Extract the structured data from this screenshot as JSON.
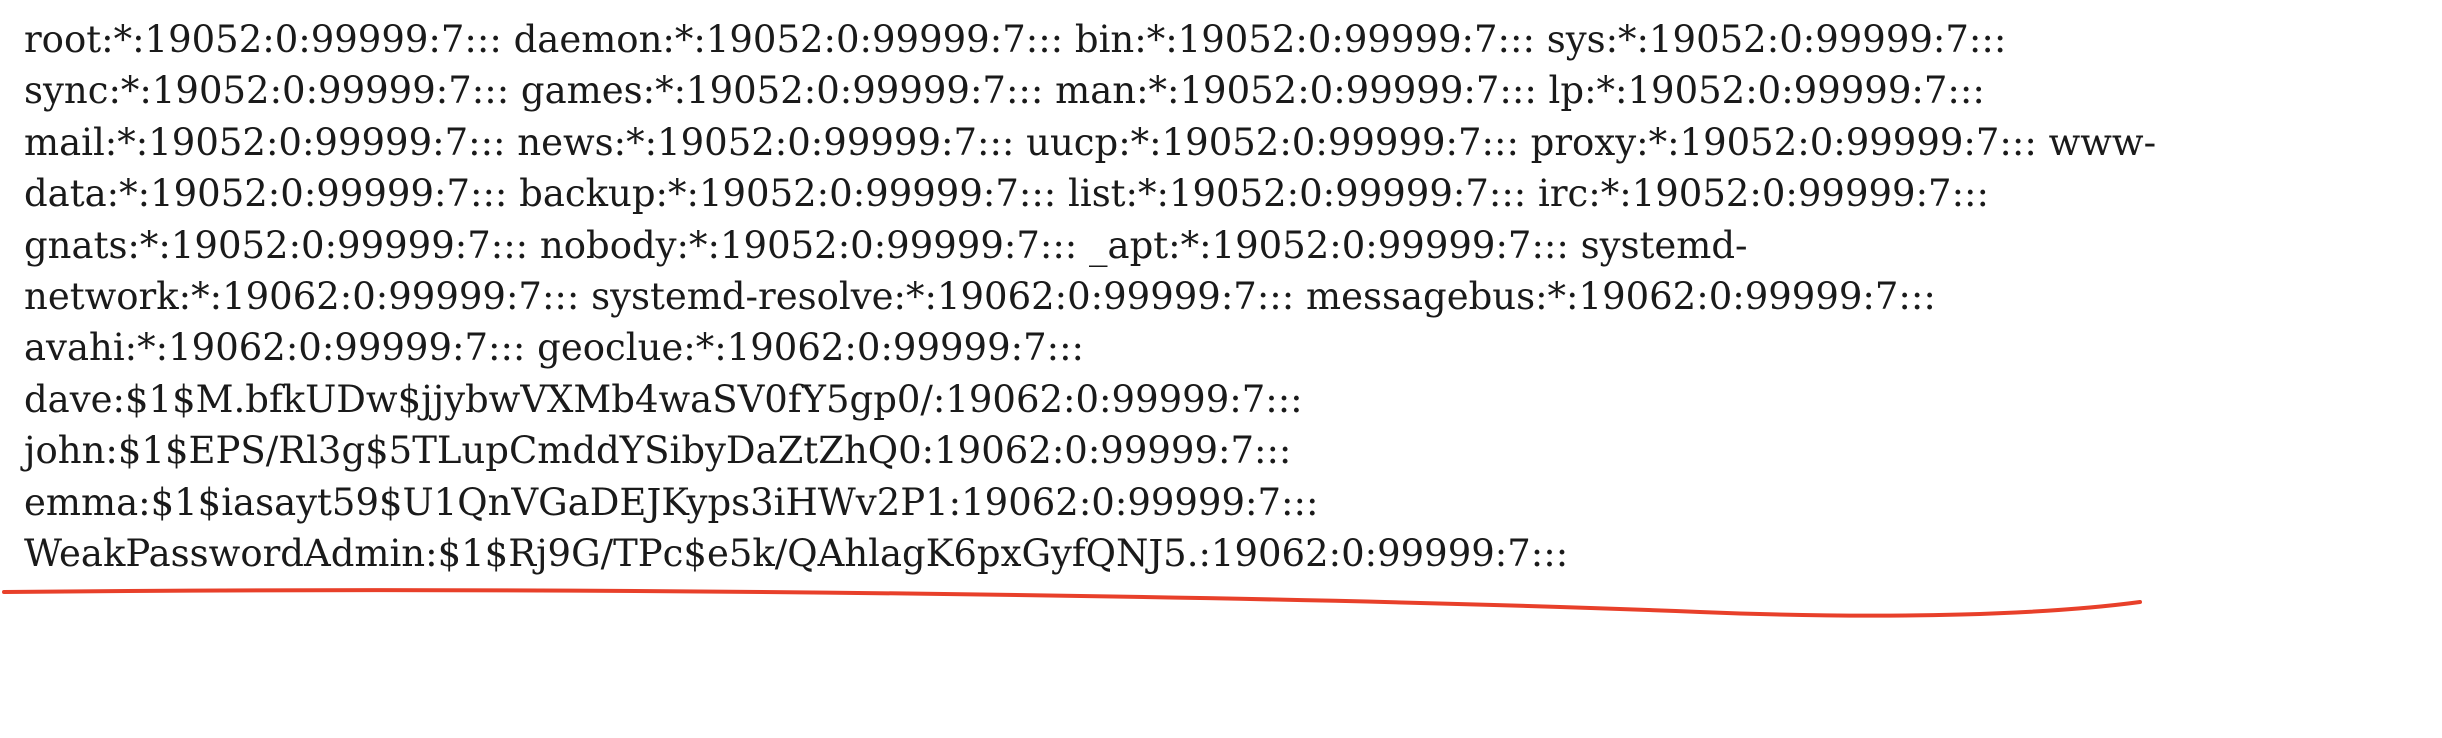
{
  "document": {
    "lines": [
      "root:*:19052:0:99999:7::: daemon:*:19052:0:99999:7::: bin:*:19052:0:99999:7::: sys:*:19052:0:99999:7:::",
      "sync:*:19052:0:99999:7::: games:*:19052:0:99999:7::: man:*:19052:0:99999:7::: lp:*:19052:0:99999:7:::",
      "mail:*:19052:0:99999:7::: news:*:19052:0:99999:7::: uucp:*:19052:0:99999:7::: proxy:*:19052:0:99999:7::: www-",
      "data:*:19052:0:99999:7::: backup:*:19052:0:99999:7::: list:*:19052:0:99999:7::: irc:*:19052:0:99999:7:::",
      "gnats:*:19052:0:99999:7::: nobody:*:19052:0:99999:7::: _apt:*:19052:0:99999:7::: systemd-",
      "network:*:19062:0:99999:7::: systemd-resolve:*:19062:0:99999:7::: messagebus:*:19062:0:99999:7:::",
      "avahi:*:19062:0:99999:7::: geoclue:*:19062:0:99999:7:::",
      "dave:$1$M.bfkUDw$jjybwVXMb4waSV0fY5gp0/:19062:0:99999:7:::",
      "john:$1$EPS/Rl3g$5TLupCmddYSibyDaZtZhQ0:19062:0:99999:7:::",
      "emma:$1$iasayt59$U1QnVGaDEJKyps3iHWv2P1:19062:0:99999:7:::",
      "WeakPasswordAdmin:$1$Rj9G/TPc$e5k/QAhlagK6pxGyfQNJ5.:19062:0:99999:7:::"
    ]
  },
  "annotation": {
    "stroke_color": "#e8402a"
  }
}
